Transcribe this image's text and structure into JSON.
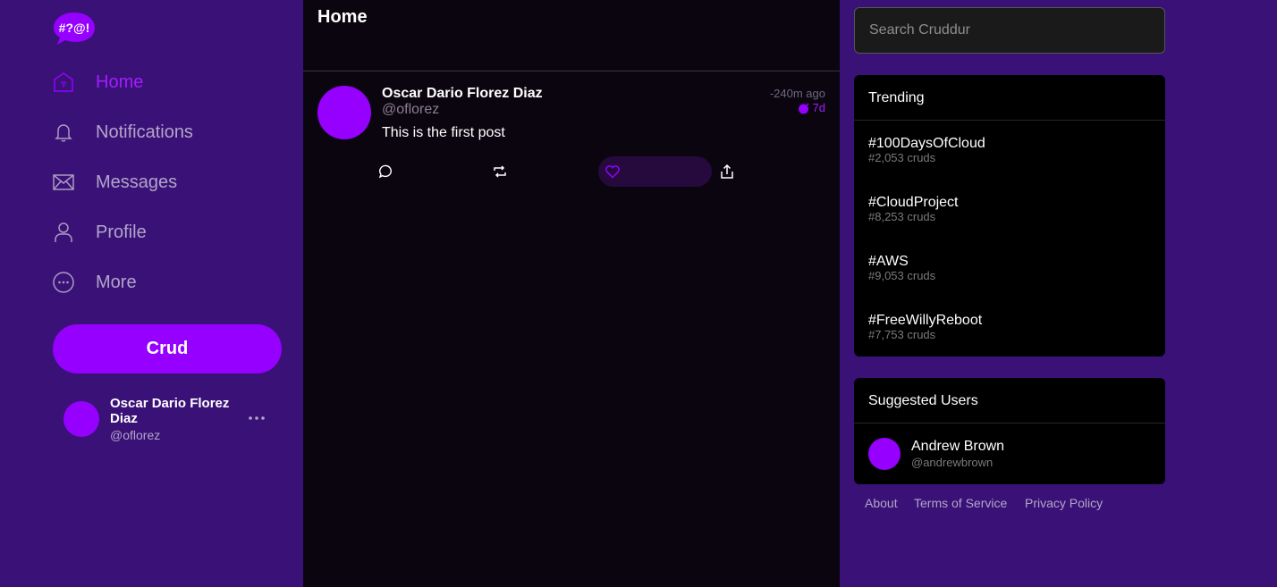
{
  "sidebar": {
    "logo_text": "#?@!",
    "nav": [
      {
        "label": "Home",
        "icon": "home-icon",
        "active": true
      },
      {
        "label": "Notifications",
        "icon": "bell-icon"
      },
      {
        "label": "Messages",
        "icon": "envelope-icon"
      },
      {
        "label": "Profile",
        "icon": "person-icon"
      },
      {
        "label": "More",
        "icon": "more-circle-icon"
      }
    ],
    "crud_button": "Crud",
    "current_user": {
      "name": "Oscar Dario Florez Diaz",
      "handle": "@oflorez"
    }
  },
  "feed": {
    "title": "Home",
    "posts": [
      {
        "name": "Oscar Dario Florez Diaz",
        "handle": "@oflorez",
        "time": "-240m ago",
        "expires": "7d",
        "body": "This is the first post"
      }
    ]
  },
  "search": {
    "placeholder": "Search Cruddur"
  },
  "trending": {
    "title": "Trending",
    "items": [
      {
        "tag": "#100DaysOfCloud",
        "count": "#2,053 cruds"
      },
      {
        "tag": "#CloudProject",
        "count": "#8,253 cruds"
      },
      {
        "tag": "#AWS",
        "count": "#9,053 cruds"
      },
      {
        "tag": "#FreeWillyReboot",
        "count": "#7,753 cruds"
      }
    ]
  },
  "suggested": {
    "title": "Suggested Users",
    "users": [
      {
        "name": "Andrew Brown",
        "handle": "@andrewbrown"
      }
    ]
  },
  "footer": {
    "about": "About",
    "terms": "Terms of Service",
    "privacy": "Privacy Policy"
  },
  "colors": {
    "accent": "#9500ff",
    "sidebar_bg": "#3a1277",
    "feed_bg": "#0b050f",
    "card_bg": "#000000"
  }
}
